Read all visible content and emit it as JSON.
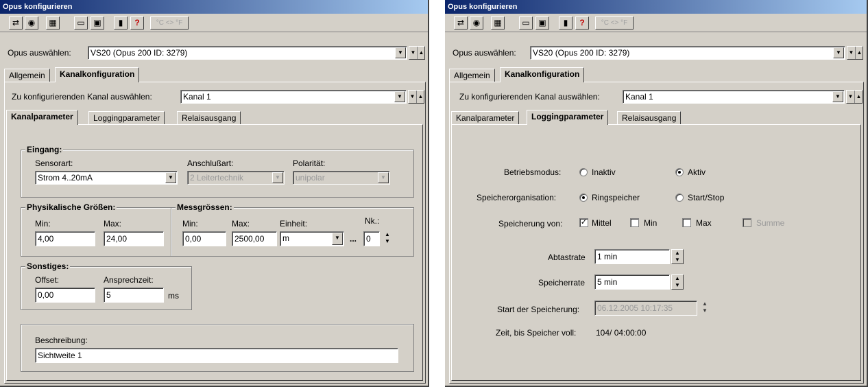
{
  "toolbar": {
    "icons": [
      "transfer-icon",
      "read-config-icon",
      "calculator-icon",
      "folder-open-icon",
      "folder-save-icon",
      "exit-icon",
      "help-icon"
    ],
    "temp_toggle": "°C <> °F"
  },
  "left": {
    "title": "Opus konfigurieren",
    "opus_label": "Opus auswählen:",
    "opus_value": "VS20 (Opus 200 ID: 3279)",
    "top_tabs": [
      "Allgemein",
      "Kanalkonfiguration"
    ],
    "channel_label": "Zu konfigurierenden Kanal auswählen:",
    "channel_value": "Kanal 1",
    "sub_tabs": [
      "Kanalparameter",
      "Loggingparameter",
      "Relaisausgang"
    ],
    "eingang": {
      "title": "Eingang:",
      "sensorart_label": "Sensorart:",
      "sensorart_value": "Strom 4..20mA",
      "anschluss_label": "Anschlußart:",
      "anschluss_value": "2 Leitertechnik",
      "polaritaet_label": "Polarität:",
      "polaritaet_value": "unipolar"
    },
    "physik": {
      "title": "Physikalische Größen:",
      "min_label": "Min:",
      "min_value": "4,00",
      "max_label": "Max:",
      "max_value": "24,00"
    },
    "mess": {
      "title": "Messgrössen:",
      "min_label": "Min:",
      "min_value": "0,00",
      "max_label": "Max:",
      "max_value": "2500,00",
      "einheit_label": "Einheit:",
      "einheit_value": "m",
      "ellipsis": "...",
      "nk_label": "Nk.:",
      "nk_value": "0"
    },
    "sonstiges": {
      "title": "Sonstiges:",
      "offset_label": "Offset:",
      "offset_value": "0,00",
      "ansprech_label": "Ansprechzeit:",
      "ansprech_value": "5",
      "unit": "ms"
    },
    "beschreibung": {
      "label": "Beschreibung:",
      "value": "Sichtweite 1"
    }
  },
  "right": {
    "title": "Opus konfigurieren",
    "opus_label": "Opus auswählen:",
    "opus_value": "VS20 (Opus 200 ID: 3279)",
    "top_tabs": [
      "Allgemein",
      "Kanalkonfiguration"
    ],
    "channel_label": "Zu konfigurierenden Kanal auswählen:",
    "channel_value": "Kanal 1",
    "sub_tabs": [
      "Kanalparameter",
      "Loggingparameter",
      "Relaisausgang"
    ],
    "betriebsmodus": {
      "label": "Betriebsmodus:",
      "opt1": "Inaktiv",
      "opt2": "Aktiv",
      "selected": "Aktiv"
    },
    "speicherorg": {
      "label": "Speicherorganisation:",
      "opt1": "Ringspeicher",
      "opt2": "Start/Stop",
      "selected": "Ringspeicher"
    },
    "speicherung": {
      "label": "Speicherung von:",
      "mittel": "Mittel",
      "min": "Min",
      "max": "Max",
      "summe": "Summe"
    },
    "abtastrate": {
      "label": "Abtastrate",
      "value": "1 min"
    },
    "speicherrate": {
      "label": "Speicherrate",
      "value": "5 min"
    },
    "start": {
      "label": "Start der Speicherung:",
      "value": "06.12.2005 10:17:35"
    },
    "zeit": {
      "label": "Zeit, bis Speicher voll:",
      "value": "104/ 04:00:00"
    }
  }
}
